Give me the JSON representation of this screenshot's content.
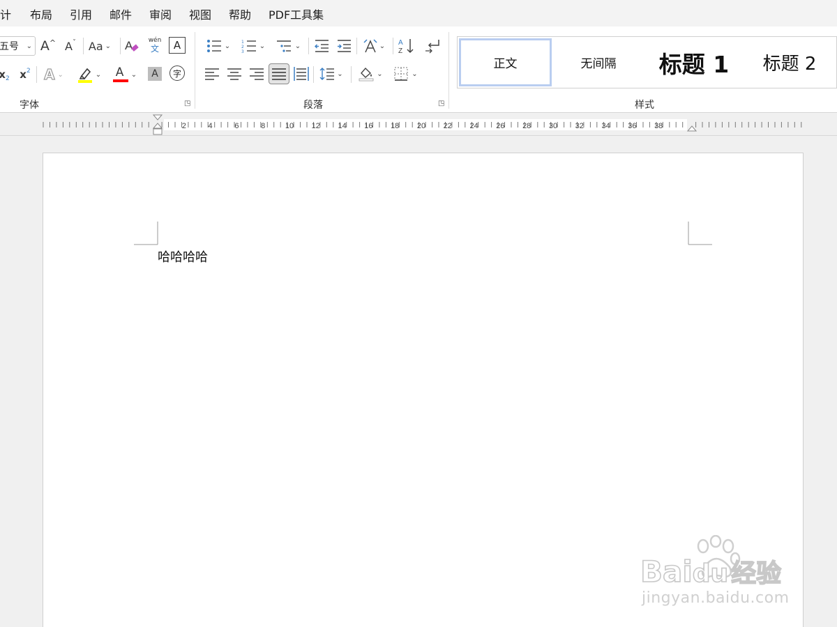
{
  "menu": {
    "items": [
      "设计",
      "布局",
      "引用",
      "邮件",
      "审阅",
      "视图",
      "帮助",
      "PDF工具集"
    ]
  },
  "ribbon": {
    "font_group": {
      "label": "字体",
      "font_size_value": "五号",
      "buttons": {
        "grow_font": "A",
        "shrink_font": "A",
        "change_case": "Aa",
        "phonetic_top": "wén",
        "phonetic_bottom": "文",
        "char_border": "A",
        "subscript": "x",
        "subscript_mark": "2",
        "superscript": "x",
        "superscript_mark": "2",
        "text_effects": "A",
        "font_color": "A",
        "char_shading": "A",
        "enclose_char": "字"
      },
      "colors": {
        "highlight": "#ffff00",
        "font_color": "#ff0000"
      }
    },
    "paragraph_group": {
      "label": "段落"
    },
    "styles_group": {
      "label": "样式",
      "styles": [
        "正文",
        "无间隔",
        "标题 1",
        "标题 2"
      ],
      "selected": "正文"
    }
  },
  "ruler": {
    "labels": [
      "2",
      "4",
      "6",
      "8",
      "10",
      "12",
      "14",
      "16",
      "18",
      "20",
      "22",
      "24",
      "26",
      "28",
      "30",
      "32",
      "34",
      "36",
      "38"
    ]
  },
  "document": {
    "body_text": "哈哈哈哈"
  },
  "watermark": {
    "brand": "Bai",
    "brand_du": "du",
    "brand_cn": "经验",
    "url": "jingyan.baidu.com"
  }
}
